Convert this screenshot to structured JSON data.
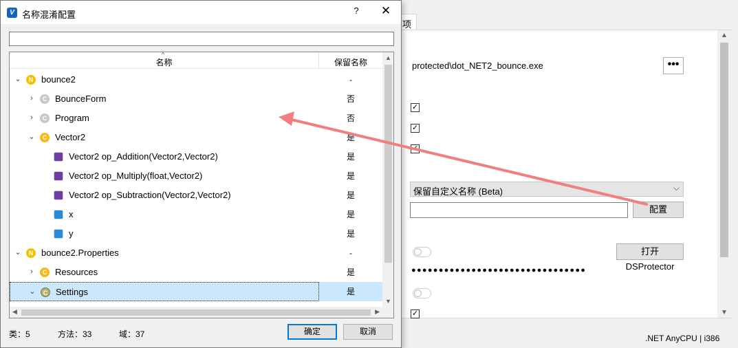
{
  "background_window": {
    "tab_label": "项",
    "output_path": "protected\\dot_NET2_bounce.exe",
    "browse_button_label": "•••",
    "rename_mode": "保留自定义名称 (Beta)",
    "config_button_label": "配置",
    "open_button_label": "打开DSProtector",
    "password_masked": "●●●●●●●●●●●●●●●●●●●●●●●●●●●●●●●●",
    "status_text": ".NET AnyCPU | i386"
  },
  "dialog": {
    "title": "名称混淆配置",
    "help_label": "?",
    "close_label": "✕",
    "search_placeholder": "",
    "columns": {
      "name": "名称",
      "keep": "保留名称"
    },
    "rows": [
      {
        "label": "bounce2",
        "keep": "-",
        "kind": "namespace",
        "expanded": true
      },
      {
        "label": "BounceForm",
        "keep": "否",
        "kind": "class",
        "expanded": false
      },
      {
        "label": "Program",
        "keep": "否",
        "kind": "class",
        "expanded": false
      },
      {
        "label": "Vector2",
        "keep": "是",
        "kind": "class",
        "expanded": true
      },
      {
        "label": "Vector2 op_Addition(Vector2,Vector2)",
        "keep": "是",
        "kind": "method"
      },
      {
        "label": "Vector2 op_Multiply(float,Vector2)",
        "keep": "是",
        "kind": "method"
      },
      {
        "label": "Vector2 op_Subtraction(Vector2,Vector2)",
        "keep": "是",
        "kind": "method"
      },
      {
        "label": "x",
        "keep": "是",
        "kind": "field"
      },
      {
        "label": "y",
        "keep": "是",
        "kind": "field"
      },
      {
        "label": "bounce2.Properties",
        "keep": "-",
        "kind": "namespace",
        "expanded": true
      },
      {
        "label": "Resources",
        "keep": "是",
        "kind": "class",
        "expanded": false
      },
      {
        "label": "Settings",
        "keep": "是",
        "kind": "class",
        "expanded": true,
        "selected": true
      }
    ],
    "stats": {
      "classes": "类：5",
      "methods": "方法：33",
      "fields": "域：37"
    },
    "ok_label": "确定",
    "cancel_label": "取消"
  },
  "colors": {
    "selection": "#cce8ff",
    "annotation_arrow": "#f08080",
    "accent": "#0078d7"
  }
}
